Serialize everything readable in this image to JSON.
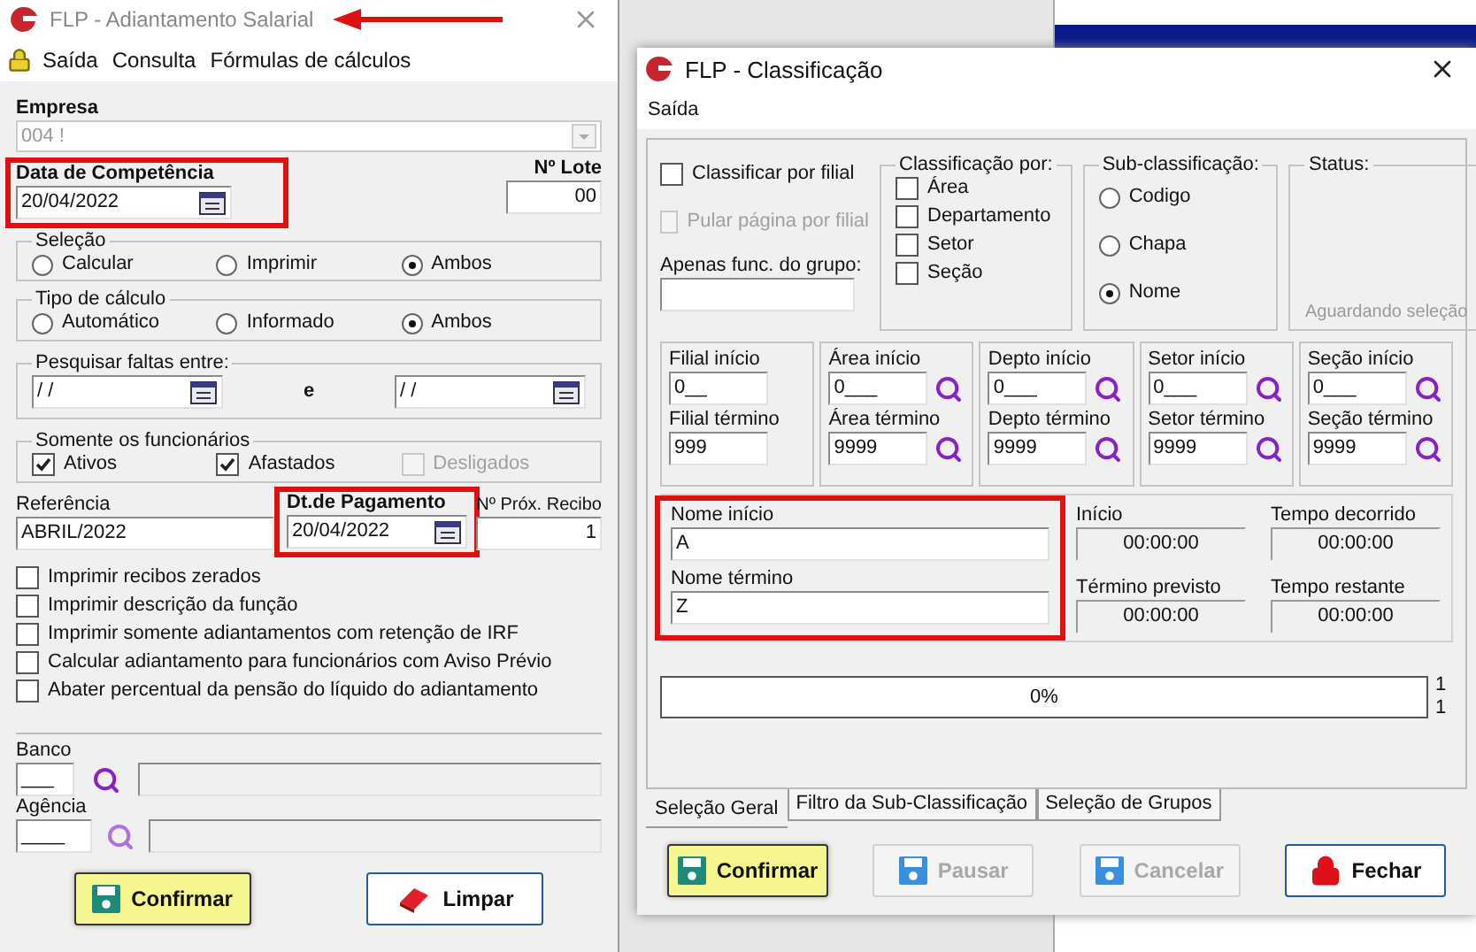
{
  "left_window": {
    "title": "FLP - Adiantamento Salarial",
    "menu": [
      "Saída",
      "Consulta",
      "Fórmulas de cálculos"
    ],
    "company": {
      "label": "Empresa",
      "value": "004 !"
    },
    "competence": {
      "label": "Data de Competência",
      "value": "20/04/2022"
    },
    "lot": {
      "label": "Nº Lote",
      "value": "00"
    },
    "selection": {
      "title": "Seleção",
      "options": [
        {
          "label": "Calcular",
          "selected": false
        },
        {
          "label": "Imprimir",
          "selected": false
        },
        {
          "label": "Ambos",
          "selected": true
        }
      ]
    },
    "calc_type": {
      "title": "Tipo de cálculo",
      "options": [
        {
          "label": "Automático",
          "selected": false
        },
        {
          "label": "Informado",
          "selected": false
        },
        {
          "label": "Ambos",
          "selected": true
        }
      ]
    },
    "absences": {
      "title": "Pesquisar faltas entre:",
      "from": "/ /",
      "separator": "e",
      "to": "/ /"
    },
    "employees": {
      "title": "Somente os funcionários",
      "options": [
        {
          "label": "Ativos",
          "checked": true,
          "disabled": false
        },
        {
          "label": "Afastados",
          "checked": true,
          "disabled": false
        },
        {
          "label": "Desligados",
          "checked": false,
          "disabled": true
        }
      ]
    },
    "reference": {
      "label": "Referência",
      "value": "ABRIL/2022"
    },
    "payment": {
      "label": "Dt.de Pagamento",
      "value": "20/04/2022"
    },
    "receipt": {
      "label": "Nº Próx. Recibo",
      "value": "1"
    },
    "options": [
      {
        "label": "Imprimir recibos zerados",
        "checked": false
      },
      {
        "label": "Imprimir descrição da função",
        "checked": false
      },
      {
        "label": "Imprimir somente adiantamentos com retenção de IRF",
        "checked": false
      },
      {
        "label": "Calcular adiantamento para funcionários com Aviso Prévio",
        "checked": false
      },
      {
        "label": "Abater percentual da pensão do líquido do adiantamento",
        "checked": false
      }
    ],
    "bank": {
      "label": "Banco",
      "value": "___"
    },
    "agency": {
      "label": "Agência",
      "value": "____"
    },
    "buttons": [
      {
        "label": "Confirmar",
        "kind": "save",
        "disabled": false
      },
      {
        "label": "Limpar",
        "kind": "eraser",
        "disabled": false
      }
    ]
  },
  "right_window": {
    "title": "FLP - Classificação",
    "menu": [
      "Saída"
    ],
    "by_branch": {
      "label": "Classificar por filial",
      "checked": false,
      "disabled": false
    },
    "skip_page": {
      "label": "Pular página por filial",
      "checked": false,
      "disabled": true
    },
    "group_only": {
      "label": "Apenas func. do grupo:"
    },
    "classification": {
      "title": "Classificação  por:",
      "options": [
        {
          "label": "Área",
          "checked": false
        },
        {
          "label": "Departamento",
          "checked": false
        },
        {
          "label": "Setor",
          "checked": false
        },
        {
          "label": "Seção",
          "checked": false
        }
      ]
    },
    "sub_classification": {
      "title": "Sub-classificação:",
      "options": [
        {
          "label": "Codigo",
          "selected": false
        },
        {
          "label": "Chapa",
          "selected": false
        },
        {
          "label": "Nome",
          "selected": true
        }
      ]
    },
    "status": {
      "title": "Status:",
      "text": "Aguardando seleção"
    },
    "ranges": [
      {
        "start_label": "Filial início",
        "start_value": "0__",
        "end_label": "Filial término",
        "end_value": "999",
        "lookup": false
      },
      {
        "start_label": "Área início",
        "start_value": "0___",
        "end_label": "Área término",
        "end_value": "9999",
        "lookup": true
      },
      {
        "start_label": "Depto início",
        "start_value": "0___",
        "end_label": "Depto término",
        "end_value": "9999",
        "lookup": true
      },
      {
        "start_label": "Setor início",
        "start_value": "0___",
        "end_label": "Setor término",
        "end_value": "9999",
        "lookup": true
      },
      {
        "start_label": "Seção início",
        "start_value": "0___",
        "end_label": "Seção término",
        "end_value": "9999",
        "lookup": true
      }
    ],
    "name_range": {
      "start_label": "Nome início",
      "start_value": "A",
      "end_label": "Nome término",
      "end_value": "Z"
    },
    "times": [
      {
        "label": "Início",
        "value": "00:00:00"
      },
      {
        "label": "Tempo decorrido",
        "value": "00:00:00"
      },
      {
        "label": "Término previsto",
        "value": "00:00:00"
      },
      {
        "label": "Tempo restante",
        "value": "00:00:00"
      }
    ],
    "progress": {
      "level": 0,
      "text": "0%"
    },
    "counters": [
      "1",
      "1"
    ],
    "tabs": [
      {
        "label": "Seleção Geral",
        "selected": true
      },
      {
        "label": "Filtro da Sub-Classificação",
        "selected": false
      },
      {
        "label": "Seleção de Grupos",
        "selected": false
      }
    ],
    "buttons": [
      {
        "label": "Confirmar",
        "kind": "save",
        "disabled": false
      },
      {
        "label": "Pausar",
        "kind": "save",
        "disabled": true
      },
      {
        "label": "Cancelar",
        "kind": "save",
        "disabled": true
      },
      {
        "label": "Fechar",
        "kind": "lock",
        "disabled": false
      }
    ]
  }
}
